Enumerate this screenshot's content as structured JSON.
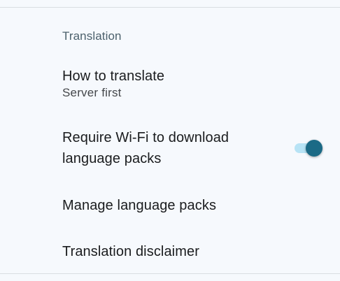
{
  "section": {
    "header": "Translation"
  },
  "items": [
    {
      "title": "How to translate",
      "summary": "Server first"
    },
    {
      "title": "Require Wi-Fi to download language packs",
      "toggle_on": true
    },
    {
      "title": "Manage language packs"
    },
    {
      "title": "Translation disclaimer"
    }
  ],
  "colors": {
    "background": "#f6f9fd",
    "accent": "#1b6a86",
    "toggle_track": "#b7e3f5"
  }
}
